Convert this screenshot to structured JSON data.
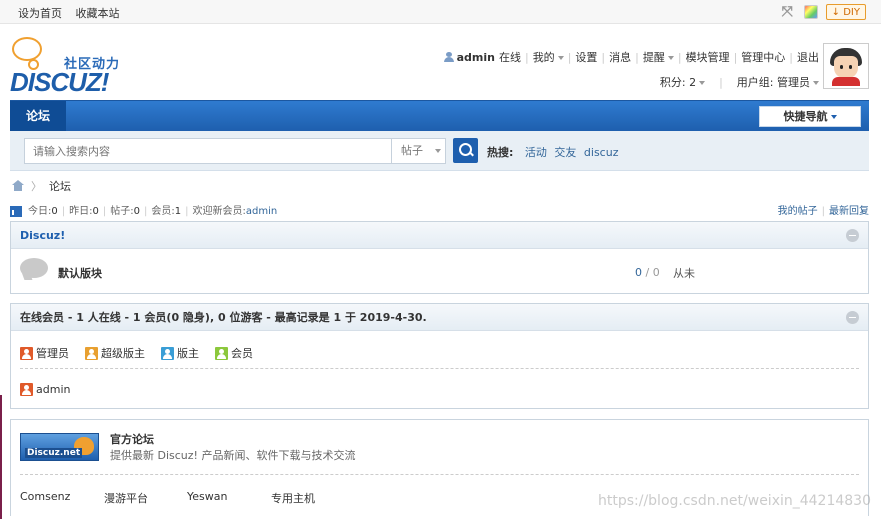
{
  "topbar": {
    "links": [
      "设为首页",
      "收藏本站"
    ],
    "diy_label": "DIY",
    "icons": [
      "expand-icon",
      "color-palette-icon"
    ]
  },
  "header": {
    "logo_cn": "社区动力",
    "logo_en": "DISCUZ!",
    "user": {
      "name": "admin",
      "status": "在线",
      "menu": [
        "我的",
        "设置",
        "消息",
        "提醒",
        "模块管理",
        "管理中心",
        "退出"
      ],
      "points_label": "积分: 2",
      "group_label": "用户组: 管理员"
    }
  },
  "nav": {
    "tab": "论坛",
    "quicknav": "快捷导航"
  },
  "search": {
    "placeholder": "请输入搜索内容",
    "type": "帖子",
    "hot_label": "热搜:",
    "hot_keywords": [
      "活动",
      "交友",
      "discuz"
    ]
  },
  "breadcrumb": {
    "current": "论坛"
  },
  "stats": {
    "today_label": "今日:",
    "today": "0",
    "yesterday_label": "昨日:",
    "yesterday": "0",
    "posts_label": "帖子:",
    "posts": "0",
    "members_label": "会员:",
    "members": "1",
    "welcome_label": "欢迎新会员:",
    "new_member": "admin",
    "my_posts": "我的帖子",
    "latest_replies": "最新回复"
  },
  "forum": {
    "category": "Discuz!",
    "name": "默认版块",
    "threads": "0",
    "posts": "0",
    "last_post": "从未"
  },
  "online": {
    "title": "在线会员 - 1 人在线 - 1 会员(0 隐身), 0 位游客 - 最高记录是 1 于 2019-4-30.",
    "legend": [
      {
        "label": "管理员",
        "color": "#e05a2a"
      },
      {
        "label": "超级版主",
        "color": "#e8a030"
      },
      {
        "label": "版主",
        "color": "#3a9ed6"
      },
      {
        "label": "会员",
        "color": "#8cc83c"
      }
    ],
    "user": "admin"
  },
  "links": {
    "logo_text": "Discuz.net",
    "title": "官方论坛",
    "desc": "提供最新 Discuz! 产品新闻、软件下载与技术交流",
    "friends": [
      "Comsenz",
      "漫游平台",
      "Yeswan",
      "专用主机"
    ]
  },
  "watermark": "https://blog.csdn.net/weixin_44214830"
}
